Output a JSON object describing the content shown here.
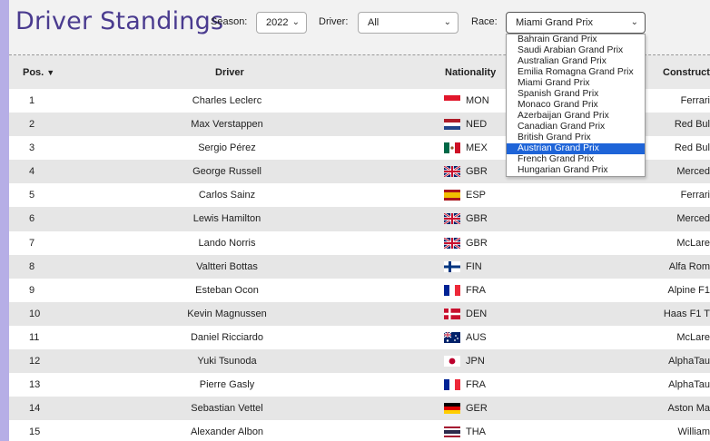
{
  "title": "Driver Standings",
  "filters": {
    "season_label": "Season:",
    "season_value": "2022",
    "driver_label": "Driver:",
    "driver_value": "All",
    "race_label": "Race:",
    "race_value": "Miami Grand Prix"
  },
  "race_options": [
    "Bahrain Grand Prix",
    "Saudi Arabian Grand Prix",
    "Australian Grand Prix",
    "Emilia Romagna Grand Prix",
    "Miami Grand Prix",
    "Spanish Grand Prix",
    "Monaco Grand Prix",
    "Azerbaijan Grand Prix",
    "Canadian Grand Prix",
    "British Grand Prix",
    "Austrian Grand Prix",
    "French Grand Prix",
    "Hungarian Grand Prix"
  ],
  "race_option_highlighted": "Austrian Grand Prix",
  "table": {
    "headers": {
      "pos": "Pos.",
      "driver": "Driver",
      "nationality": "Nationality",
      "constructor": "Construct"
    },
    "rows": [
      {
        "pos": "1",
        "driver": "Charles Leclerc",
        "nat": "MON",
        "flag": "monaco-flag-icon",
        "con": "Ferrari"
      },
      {
        "pos": "2",
        "driver": "Max Verstappen",
        "nat": "NED",
        "flag": "netherlands-flag-icon",
        "con": "Red Bul"
      },
      {
        "pos": "3",
        "driver": "Sergio Pérez",
        "nat": "MEX",
        "flag": "mexico-flag-icon",
        "con": "Red Bul"
      },
      {
        "pos": "4",
        "driver": "George Russell",
        "nat": "GBR",
        "flag": "uk-flag-icon",
        "con": "Merced"
      },
      {
        "pos": "5",
        "driver": "Carlos Sainz",
        "nat": "ESP",
        "flag": "spain-flag-icon",
        "con": "Ferrari"
      },
      {
        "pos": "6",
        "driver": "Lewis Hamilton",
        "nat": "GBR",
        "flag": "uk-flag-icon",
        "con": "Merced"
      },
      {
        "pos": "7",
        "driver": "Lando Norris",
        "nat": "GBR",
        "flag": "uk-flag-icon",
        "con": "McLare"
      },
      {
        "pos": "8",
        "driver": "Valtteri Bottas",
        "nat": "FIN",
        "flag": "finland-flag-icon",
        "con": "Alfa Rom"
      },
      {
        "pos": "9",
        "driver": "Esteban Ocon",
        "nat": "FRA",
        "flag": "france-flag-icon",
        "con": "Alpine F1"
      },
      {
        "pos": "10",
        "driver": "Kevin Magnussen",
        "nat": "DEN",
        "flag": "denmark-flag-icon",
        "con": "Haas F1 T"
      },
      {
        "pos": "11",
        "driver": "Daniel Ricciardo",
        "nat": "AUS",
        "flag": "australia-flag-icon",
        "con": "McLare"
      },
      {
        "pos": "12",
        "driver": "Yuki Tsunoda",
        "nat": "JPN",
        "flag": "japan-flag-icon",
        "con": "AlphaTau"
      },
      {
        "pos": "13",
        "driver": "Pierre Gasly",
        "nat": "FRA",
        "flag": "france-flag-icon",
        "con": "AlphaTau"
      },
      {
        "pos": "14",
        "driver": "Sebastian Vettel",
        "nat": "GER",
        "flag": "germany-flag-icon",
        "con": "Aston Ma"
      },
      {
        "pos": "15",
        "driver": "Alexander Albon",
        "nat": "THA",
        "flag": "thailand-flag-icon",
        "con": "William"
      }
    ]
  },
  "colors": {
    "title": "#4a3b8f",
    "frame": "#b6aee6",
    "highlight": "#1e64d8"
  }
}
